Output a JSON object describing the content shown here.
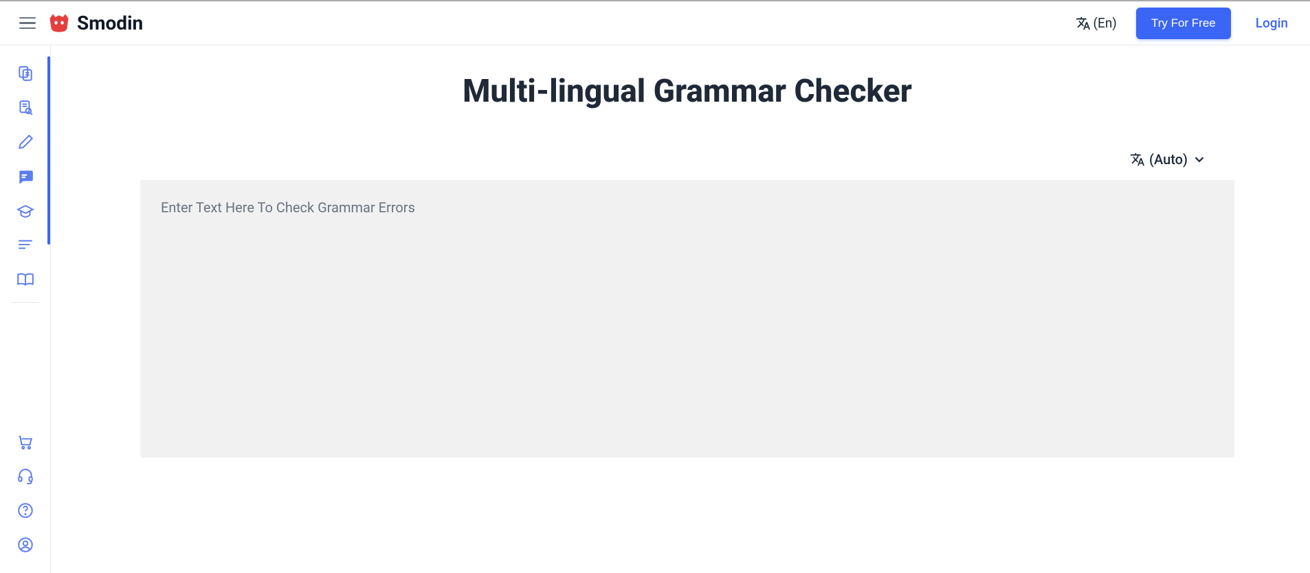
{
  "header": {
    "brand": "Smodin",
    "language_label": "(En)",
    "try_free_label": "Try For Free",
    "login_label": "Login"
  },
  "main": {
    "title": "Multi-lingual Grammar Checker",
    "auto_lang_label": "(Auto)",
    "textarea_placeholder": "Enter Text Here To Check Grammar Errors"
  }
}
